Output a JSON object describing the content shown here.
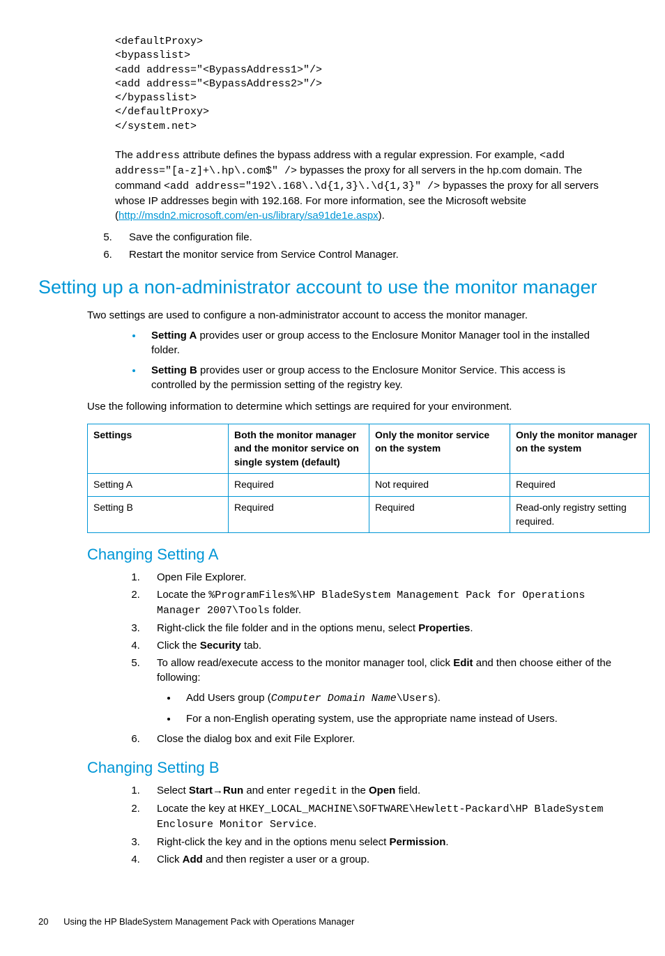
{
  "code_block": "<defaultProxy>\n<bypasslist>\n<add address=\"<BypassAddress1>\"/>\n<add address=\"<BypassAddress2>\"/>\n</bypasslist>\n</defaultProxy>\n</system.net>",
  "para1_pre": "The ",
  "para1_code1": "address",
  "para1_mid1": " attribute defines the bypass address with a regular expression. For example, ",
  "para1_code2": "<add address=\"[a-z]+\\.hp\\.com$\" />",
  "para1_mid2": " bypasses the proxy for all servers in the hp.com domain. The command ",
  "para1_code3": "<add address=\"192\\.168\\.\\d{1,3}\\.\\d{1,3}\" />",
  "para1_mid3": " bypasses the proxy for all servers whose IP addresses begin with 192.168. For more information, see the Microsoft website (",
  "para1_link": "http://msdn2.microsoft.com/en-us/library/sa91de1e.aspx",
  "para1_end": ").",
  "ol1_item5": "Save the configuration file.",
  "ol1_item6": "Restart the monitor service from Service Control Manager.",
  "h1": "Setting up a non-administrator account to use the monitor manager",
  "p_intro": "Two settings are used to configure a non-administrator account to access the monitor manager.",
  "bullet_a_bold": "Setting A",
  "bullet_a_text": " provides user or group access to the Enclosure Monitor Manager tool in the installed folder.",
  "bullet_b_bold": "Setting B",
  "bullet_b_text": " provides user or group access to the Enclosure Monitor Service. This access is controlled by the permission setting of the registry key.",
  "p_use": "Use the following information to determine which settings are required for your environment.",
  "table": {
    "headers": [
      "Settings",
      "Both the monitor manager and the monitor service on single system (default)",
      "Only the monitor service on the system",
      "Only the monitor manager on the system"
    ],
    "rows": [
      [
        "Setting A",
        "Required",
        "Not required",
        "Required"
      ],
      [
        "Setting B",
        "Required",
        "Required",
        "Read-only registry setting required."
      ]
    ]
  },
  "h2a": "Changing Setting A",
  "a1": "Open File Explorer.",
  "a2_pre": "Locate the ",
  "a2_code": "%ProgramFiles%\\HP BladeSystem Management Pack for Operations Manager 2007\\Tools",
  "a2_post": " folder.",
  "a3_pre": "Right-click the file folder and in the options menu, select ",
  "a3_bold": "Properties",
  "a3_post": ".",
  "a4_pre": "Click the ",
  "a4_bold": "Security",
  "a4_post": " tab.",
  "a5_pre": "To allow read/execute access to the monitor manager tool, click ",
  "a5_bold": "Edit",
  "a5_post": " and then choose either of the following:",
  "a5_sub1_pre": "Add Users group (",
  "a5_sub1_italic": "Computer Domain Name",
  "a5_sub1_code": "\\Users",
  "a5_sub1_post": ").",
  "a5_sub2": "For a non-English operating system, use the appropriate name instead of Users.",
  "a6": "Close the dialog box and exit File Explorer.",
  "h2b": "Changing Setting B",
  "b1_pre": "Select ",
  "b1_b1": "Start",
  "b1_arrow": "→",
  "b1_b2": "Run",
  "b1_mid": " and enter ",
  "b1_code": "regedit",
  "b1_mid2": " in the ",
  "b1_b3": "Open",
  "b1_post": " field.",
  "b2_pre": "Locate the key at ",
  "b2_code": "HKEY_LOCAL_MACHINE\\SOFTWARE\\Hewlett-Packard\\HP BladeSystem Enclosure Monitor Service",
  "b2_post": ".",
  "b3_pre": "Right-click the key and in the options menu select ",
  "b3_bold": "Permission",
  "b3_post": ".",
  "b4_pre": "Click ",
  "b4_bold": "Add",
  "b4_post": " and then register a user or a group.",
  "footer_page": "20",
  "footer_text": "Using the HP BladeSystem Management Pack with Operations Manager"
}
